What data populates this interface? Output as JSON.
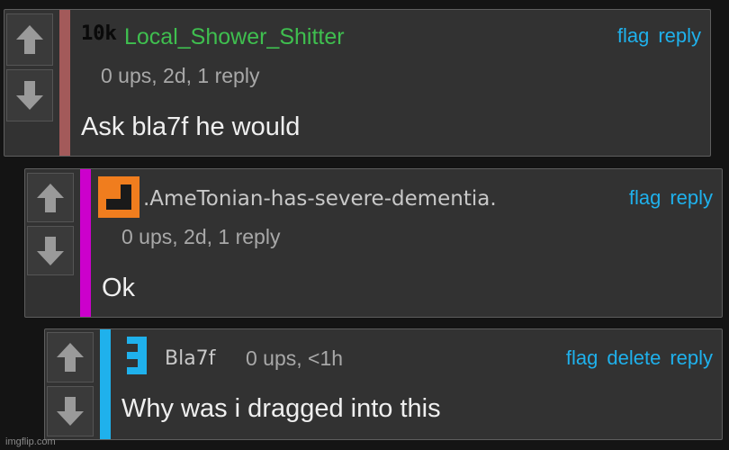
{
  "comments": [
    {
      "username": "Local_Shower_Shitter",
      "badge": "10k",
      "username_color": "#3fbf4f",
      "stripe_color": "#a35a5a",
      "meta": "0 ups, 2d, 1 reply",
      "text": "Ask bla7f he would",
      "actions": [
        "flag",
        "reply"
      ]
    },
    {
      "username": ".AmeTonian-has-severe-dementia.",
      "avatar_color": "#f07d1e",
      "username_color": "#c8c8c8",
      "stripe_color": "#cc00cc",
      "meta": "0 ups, 2d, 1 reply",
      "text": "Ok",
      "actions": [
        "flag",
        "reply"
      ]
    },
    {
      "username": "Bla7f",
      "avatar_color": "#1fb1ec",
      "username_color": "#c8c8c8",
      "stripe_color": "#1fb1ec",
      "meta": "0 ups, <1h",
      "text": "Why was i dragged into this",
      "actions": [
        "flag",
        "delete",
        "reply"
      ]
    }
  ],
  "watermark": "imgflip.com",
  "icons": {
    "upvote": "arrow-up-icon",
    "downvote": "arrow-down-icon"
  }
}
